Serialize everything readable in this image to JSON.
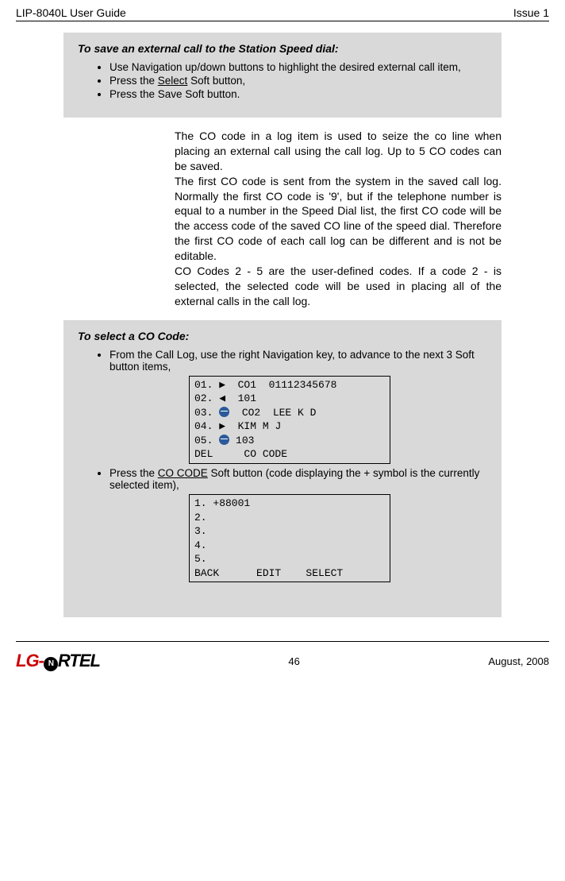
{
  "header": {
    "left": "LIP-8040L User Guide",
    "right": "Issue 1"
  },
  "box1": {
    "title": "To save an external call to the Station Speed dial:",
    "items": [
      "Use Navigation up/down buttons to highlight the desired external call item,",
      "Press the <u>Select</u> Soft button,",
      "Press the Save Soft button."
    ]
  },
  "para1": "The CO code in a log item is used to seize the co line when placing an external call using the call log. Up to 5 CO codes can be saved.",
  "para2": "The first CO code is sent from the system in the saved call log. Normally the first CO code is '9', but if the telephone number is equal to a number in the Speed Dial list, the first CO code will be the access code of the saved CO line of the speed dial. Therefore the first CO code of each call log can be different and is not be editable.",
  "para3": "CO Codes 2 - 5 are the user-defined codes. If a code 2 - is selected, the selected code will be used in placing all of the external calls in the call log.",
  "box2": {
    "title": "To select a CO Code:",
    "item1": "From the Call Log, use the right Navigation key, to advance to the next 3 Soft button items,",
    "screen1": {
      "r1": "01. ▶  CO1  01112345678",
      "r2": "02. ◀  101",
      "r3a": "03. ",
      "r3b": "  CO2  LEE K D",
      "r4": "04. ▶  KIM M J",
      "r5a": "05. ",
      "r5b": " 103",
      "r6": "DEL     CO CODE"
    },
    "item2": "Press the <u>CO CODE</u> Soft button (code displaying the + symbol is the currently selected item),",
    "screen2": {
      "r1": "1. +88001",
      "r2": "2.",
      "r3": "3.",
      "r4": "4.",
      "r5": "5.",
      "r6": "BACK      EDIT    SELECT"
    }
  },
  "footer": {
    "page": "46",
    "date": "August, 2008",
    "logo_lg": "LG-",
    "logo_nortel": "RTEL"
  }
}
